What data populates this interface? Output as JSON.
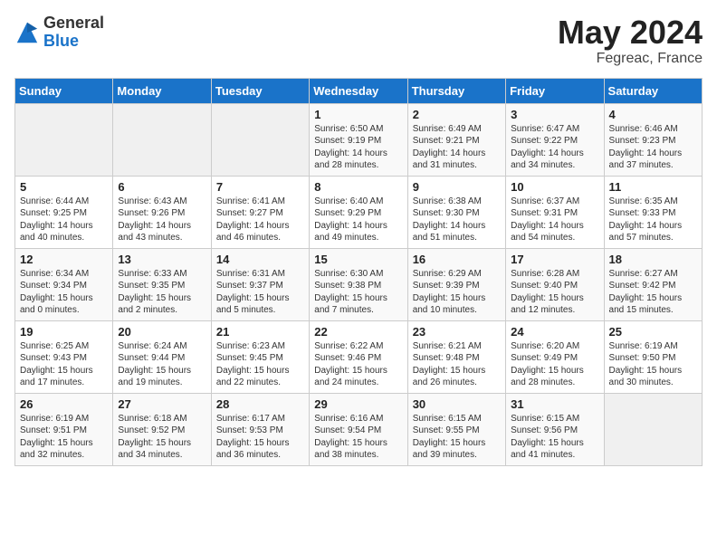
{
  "logo": {
    "general": "General",
    "blue": "Blue"
  },
  "title": {
    "month_year": "May 2024",
    "location": "Fegreac, France"
  },
  "weekdays": [
    "Sunday",
    "Monday",
    "Tuesday",
    "Wednesday",
    "Thursday",
    "Friday",
    "Saturday"
  ],
  "weeks": [
    [
      {
        "day": "",
        "info": ""
      },
      {
        "day": "",
        "info": ""
      },
      {
        "day": "",
        "info": ""
      },
      {
        "day": "1",
        "info": "Sunrise: 6:50 AM\nSunset: 9:19 PM\nDaylight: 14 hours and 28 minutes."
      },
      {
        "day": "2",
        "info": "Sunrise: 6:49 AM\nSunset: 9:21 PM\nDaylight: 14 hours and 31 minutes."
      },
      {
        "day": "3",
        "info": "Sunrise: 6:47 AM\nSunset: 9:22 PM\nDaylight: 14 hours and 34 minutes."
      },
      {
        "day": "4",
        "info": "Sunrise: 6:46 AM\nSunset: 9:23 PM\nDaylight: 14 hours and 37 minutes."
      }
    ],
    [
      {
        "day": "5",
        "info": "Sunrise: 6:44 AM\nSunset: 9:25 PM\nDaylight: 14 hours and 40 minutes."
      },
      {
        "day": "6",
        "info": "Sunrise: 6:43 AM\nSunset: 9:26 PM\nDaylight: 14 hours and 43 minutes."
      },
      {
        "day": "7",
        "info": "Sunrise: 6:41 AM\nSunset: 9:27 PM\nDaylight: 14 hours and 46 minutes."
      },
      {
        "day": "8",
        "info": "Sunrise: 6:40 AM\nSunset: 9:29 PM\nDaylight: 14 hours and 49 minutes."
      },
      {
        "day": "9",
        "info": "Sunrise: 6:38 AM\nSunset: 9:30 PM\nDaylight: 14 hours and 51 minutes."
      },
      {
        "day": "10",
        "info": "Sunrise: 6:37 AM\nSunset: 9:31 PM\nDaylight: 14 hours and 54 minutes."
      },
      {
        "day": "11",
        "info": "Sunrise: 6:35 AM\nSunset: 9:33 PM\nDaylight: 14 hours and 57 minutes."
      }
    ],
    [
      {
        "day": "12",
        "info": "Sunrise: 6:34 AM\nSunset: 9:34 PM\nDaylight: 15 hours and 0 minutes."
      },
      {
        "day": "13",
        "info": "Sunrise: 6:33 AM\nSunset: 9:35 PM\nDaylight: 15 hours and 2 minutes."
      },
      {
        "day": "14",
        "info": "Sunrise: 6:31 AM\nSunset: 9:37 PM\nDaylight: 15 hours and 5 minutes."
      },
      {
        "day": "15",
        "info": "Sunrise: 6:30 AM\nSunset: 9:38 PM\nDaylight: 15 hours and 7 minutes."
      },
      {
        "day": "16",
        "info": "Sunrise: 6:29 AM\nSunset: 9:39 PM\nDaylight: 15 hours and 10 minutes."
      },
      {
        "day": "17",
        "info": "Sunrise: 6:28 AM\nSunset: 9:40 PM\nDaylight: 15 hours and 12 minutes."
      },
      {
        "day": "18",
        "info": "Sunrise: 6:27 AM\nSunset: 9:42 PM\nDaylight: 15 hours and 15 minutes."
      }
    ],
    [
      {
        "day": "19",
        "info": "Sunrise: 6:25 AM\nSunset: 9:43 PM\nDaylight: 15 hours and 17 minutes."
      },
      {
        "day": "20",
        "info": "Sunrise: 6:24 AM\nSunset: 9:44 PM\nDaylight: 15 hours and 19 minutes."
      },
      {
        "day": "21",
        "info": "Sunrise: 6:23 AM\nSunset: 9:45 PM\nDaylight: 15 hours and 22 minutes."
      },
      {
        "day": "22",
        "info": "Sunrise: 6:22 AM\nSunset: 9:46 PM\nDaylight: 15 hours and 24 minutes."
      },
      {
        "day": "23",
        "info": "Sunrise: 6:21 AM\nSunset: 9:48 PM\nDaylight: 15 hours and 26 minutes."
      },
      {
        "day": "24",
        "info": "Sunrise: 6:20 AM\nSunset: 9:49 PM\nDaylight: 15 hours and 28 minutes."
      },
      {
        "day": "25",
        "info": "Sunrise: 6:19 AM\nSunset: 9:50 PM\nDaylight: 15 hours and 30 minutes."
      }
    ],
    [
      {
        "day": "26",
        "info": "Sunrise: 6:19 AM\nSunset: 9:51 PM\nDaylight: 15 hours and 32 minutes."
      },
      {
        "day": "27",
        "info": "Sunrise: 6:18 AM\nSunset: 9:52 PM\nDaylight: 15 hours and 34 minutes."
      },
      {
        "day": "28",
        "info": "Sunrise: 6:17 AM\nSunset: 9:53 PM\nDaylight: 15 hours and 36 minutes."
      },
      {
        "day": "29",
        "info": "Sunrise: 6:16 AM\nSunset: 9:54 PM\nDaylight: 15 hours and 38 minutes."
      },
      {
        "day": "30",
        "info": "Sunrise: 6:15 AM\nSunset: 9:55 PM\nDaylight: 15 hours and 39 minutes."
      },
      {
        "day": "31",
        "info": "Sunrise: 6:15 AM\nSunset: 9:56 PM\nDaylight: 15 hours and 41 minutes."
      },
      {
        "day": "",
        "info": ""
      }
    ]
  ]
}
